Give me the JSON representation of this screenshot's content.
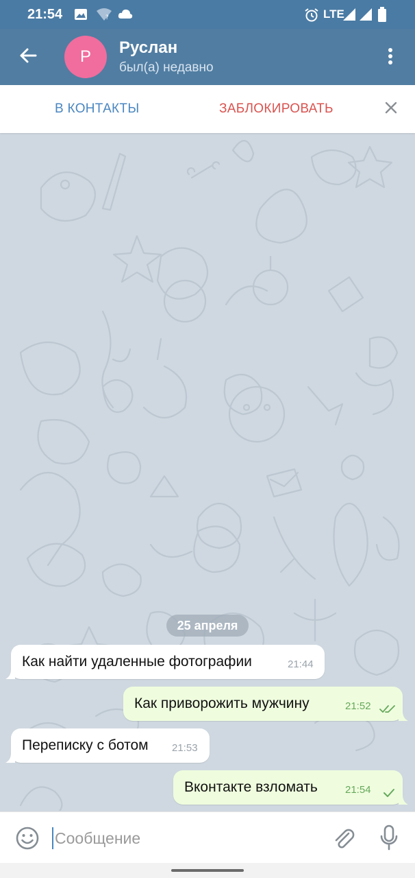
{
  "status_bar": {
    "time": "21:54",
    "network": "LTE",
    "icons": [
      "image-icon",
      "wifi-question-icon",
      "cloud-icon",
      "alarm-icon",
      "signal-icon",
      "signal-icon",
      "battery-icon"
    ]
  },
  "header": {
    "avatar_letter": "Р",
    "avatar_color": "#f06d9d",
    "name": "Руслан",
    "status": "был(а) недавно",
    "icons": [
      "back-arrow-icon",
      "more-vertical-icon"
    ]
  },
  "action_bar": {
    "add_contact": "В КОНТАКТЫ",
    "block": "ЗАБЛОКИРОВАТЬ",
    "close_icon": "close-icon"
  },
  "chat": {
    "date_divider": "25 апреля",
    "messages": [
      {
        "direction": "in",
        "text": "Как найти удаленные фотографии",
        "time": "21:44"
      },
      {
        "direction": "out",
        "text": "Как приворожить мужчину",
        "time": "21:52",
        "status": "read"
      },
      {
        "direction": "in",
        "text": "Переписку с ботом",
        "time": "21:53"
      },
      {
        "direction": "out",
        "text": "Вконтакте взломать",
        "time": "21:54",
        "status": "sent"
      }
    ]
  },
  "composer": {
    "placeholder": "Сообщение",
    "icons": [
      "emoji-icon",
      "paperclip-icon",
      "microphone-icon"
    ]
  },
  "colors": {
    "header_bg": "#517da2",
    "outgoing_bubble": "#effdde",
    "incoming_bubble": "#ffffff",
    "wallpaper": "#cfd8e0",
    "block_red": "#d9534f",
    "link_blue": "#4a86c0"
  }
}
